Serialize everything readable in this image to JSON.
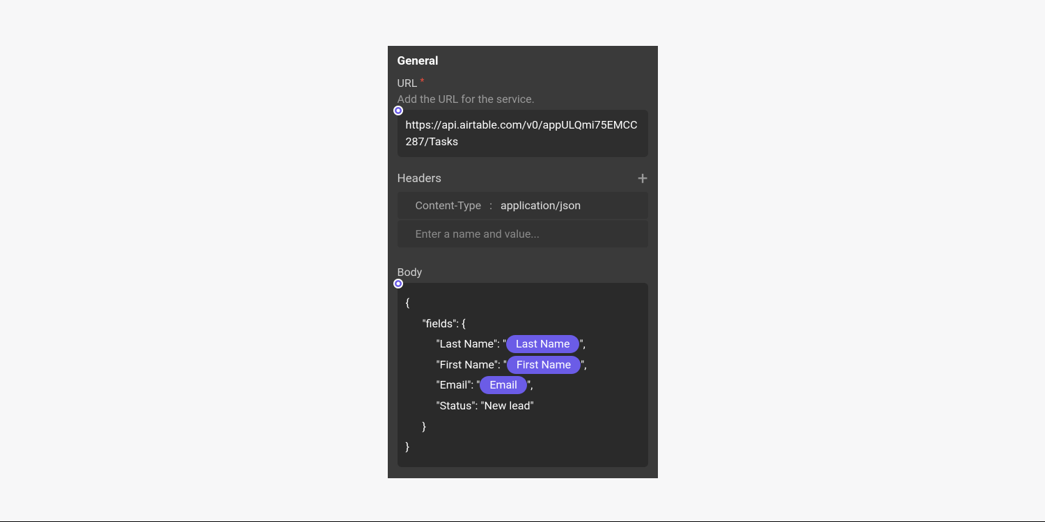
{
  "panel": {
    "title": "General",
    "url": {
      "label": "URL",
      "required_marker": "*",
      "help": "Add the URL for the service.",
      "value": "https://api.airtable.com/v0/appULQmi75EMCC287/Tasks"
    },
    "headers": {
      "label": "Headers",
      "rows": [
        {
          "name": "Content-Type",
          "sep": ":",
          "value": "application/json"
        }
      ],
      "placeholder": "Enter a name and value..."
    },
    "body": {
      "label": "Body",
      "lines": {
        "l0": "{",
        "l1": "\"fields\": {",
        "l2_pre": "\"Last Name\": \"",
        "l2_pill": "Last Name",
        "l2_post": "\",",
        "l3_pre": "\"First Name\": \"",
        "l3_pill": "First Name",
        "l3_post": "\",",
        "l4_pre": "\"Email\": \"",
        "l4_pill": "Email",
        "l4_post": "\",",
        "l5": "\"Status\": \"New lead\"",
        "l6": "}",
        "l7": "}"
      }
    }
  }
}
